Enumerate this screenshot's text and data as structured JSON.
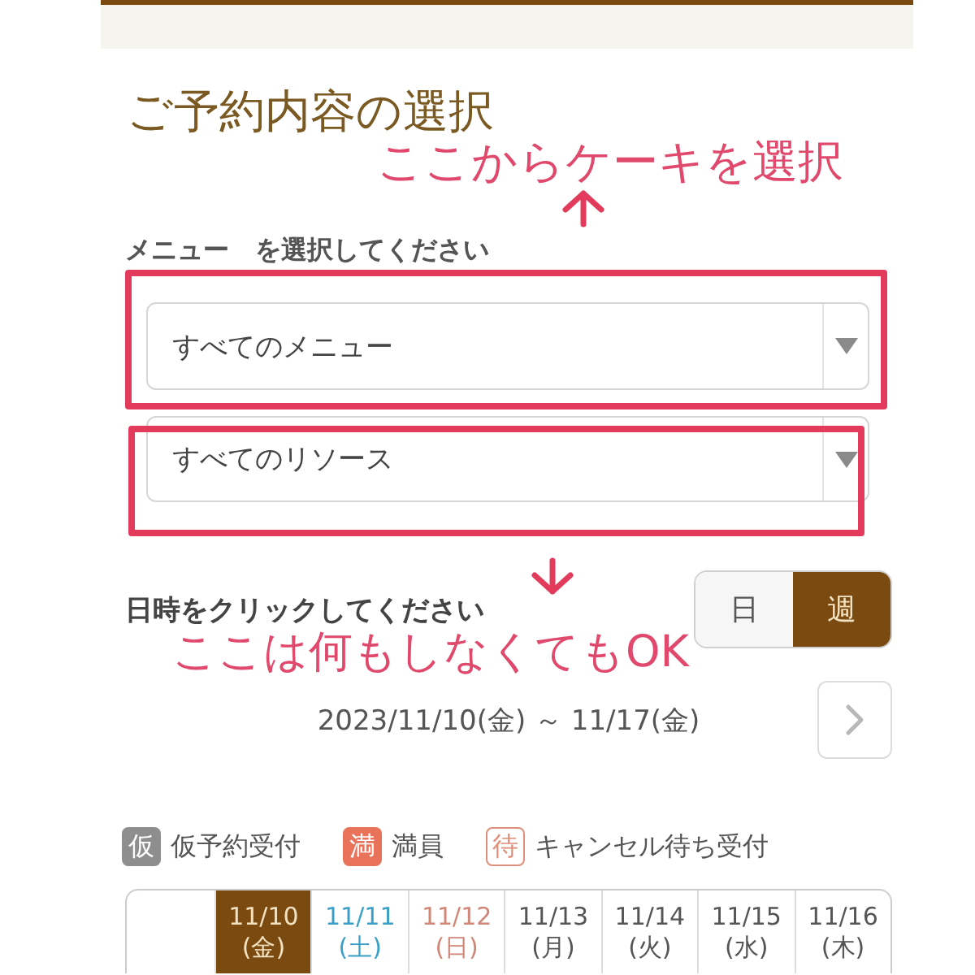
{
  "page": {
    "title": "ご予約内容の選択"
  },
  "menu_section": {
    "label": "メニュー　を選択してください",
    "selects": [
      {
        "value": "すべてのメニュー"
      },
      {
        "value": "すべてのリソース"
      }
    ]
  },
  "date_section": {
    "label": "日時をクリックしてください",
    "view_toggle": [
      {
        "label": "日",
        "selected": false
      },
      {
        "label": "週",
        "selected": true
      }
    ],
    "range": "2023/11/10(金) ～ 11/17(金)"
  },
  "legend": [
    {
      "kind": "tentative",
      "badge": "仮",
      "label": "仮予約受付"
    },
    {
      "kind": "full",
      "badge": "満",
      "label": "満員"
    },
    {
      "kind": "waitlist",
      "badge": "待",
      "label": "キャンセル待ち受付"
    }
  ],
  "calendar": {
    "days": [
      {
        "date": "11/10",
        "weekday": "(金)",
        "kind": "weekday",
        "selected": true
      },
      {
        "date": "11/11",
        "weekday": "(土)",
        "kind": "saturday",
        "selected": false
      },
      {
        "date": "11/12",
        "weekday": "(日)",
        "kind": "sunday",
        "selected": false
      },
      {
        "date": "11/13",
        "weekday": "(月)",
        "kind": "weekday",
        "selected": false
      },
      {
        "date": "11/14",
        "weekday": "(火)",
        "kind": "weekday",
        "selected": false
      },
      {
        "date": "11/15",
        "weekday": "(水)",
        "kind": "weekday",
        "selected": false
      },
      {
        "date": "11/16",
        "weekday": "(木)",
        "kind": "weekday",
        "selected": false
      }
    ]
  },
  "annotations": [
    {
      "text": "ここからケーキを選択"
    },
    {
      "text": "ここは何もしなくてもOK"
    }
  ]
}
